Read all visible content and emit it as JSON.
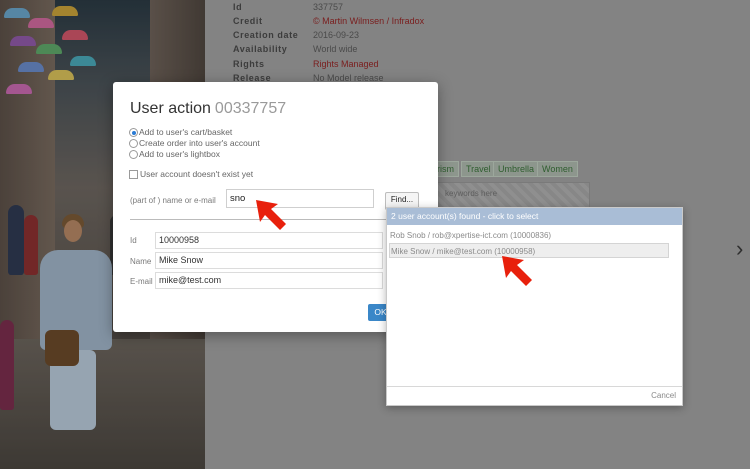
{
  "background": {
    "meta": [
      {
        "key": "Id",
        "value": "337757",
        "red": false
      },
      {
        "key": "Credit",
        "value": "© Martin Wilmsen / Infradox",
        "red": true
      },
      {
        "key": "Creation date",
        "value": "2016-09-23",
        "red": false
      },
      {
        "key": "Availability",
        "value": "World wide",
        "red": false
      },
      {
        "key": "Rights",
        "value": "Rights Managed",
        "red": true
      },
      {
        "key": "Release",
        "value": "No Model release",
        "red": false
      }
    ],
    "tags": [
      "rism",
      "Travel",
      "Umbrella",
      "Women"
    ],
    "keywords_placeholder": "keywords here",
    "next_chevron": "›"
  },
  "dialog": {
    "title": "User action",
    "title_number": "00337757",
    "options": [
      {
        "label": "Add to user's cart/basket",
        "checked": true
      },
      {
        "label": "Create order into user's account",
        "checked": false
      },
      {
        "label": "Add to user's lightbox",
        "checked": false
      }
    ],
    "checkbox_label": "User account doesn't exist yet",
    "name_label": "(part of ) name or e-mail",
    "name_value": "sno",
    "find_label": "Find...",
    "fields": [
      {
        "label": "Id",
        "value": "10000958"
      },
      {
        "label": "Name",
        "value": "Mike Snow"
      },
      {
        "label": "E-mail",
        "value": "mike@test.com"
      }
    ],
    "ok_label": "OK"
  },
  "popup": {
    "header": "2 user account(s) found - click to select",
    "items": [
      {
        "label": "Rob Snob / rob@xpertise-ict.com (10000836)"
      },
      {
        "label": "Mike Snow / mike@test.com (10000958)"
      }
    ],
    "cancel_label": "Cancel"
  },
  "colors": {
    "accent": "#3a87c8",
    "popup_header": "#a9bdd6",
    "arrow": "#e8200c",
    "rights_text": "#7a1d1d"
  }
}
